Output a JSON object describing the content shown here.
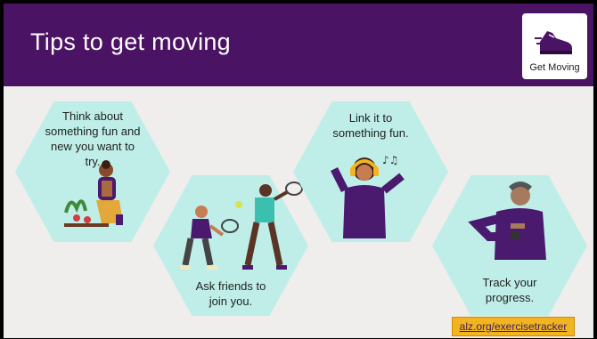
{
  "header": {
    "title": "Tips to get moving",
    "badge_label": "Get Moving",
    "badge_icon": "running-shoe-icon"
  },
  "tips": [
    {
      "text": "Think about something fun and new you want to try.",
      "lines": [
        "Think about",
        "something fun and",
        "new you want to try."
      ],
      "icon": "gardening-person"
    },
    {
      "text": "Ask friends to join you.",
      "lines": [
        "Ask friends to",
        "join you."
      ],
      "icon": "tennis-players"
    },
    {
      "text": "Link it to something fun.",
      "lines": [
        "Link it to",
        "something fun."
      ],
      "icon": "person-with-headphones"
    },
    {
      "text": "Track your progress.",
      "lines": [
        "Track your",
        "progress."
      ],
      "icon": "person-checking-watch"
    }
  ],
  "footer": {
    "link_text": "alz.org/exercisetracker"
  },
  "colors": {
    "header_bg": "#4b1364",
    "hexagon": "#bfeee8",
    "slide_bg": "#efeeec",
    "link_bg": "#f2b51f",
    "figure_purple": "#4a1a6e"
  }
}
